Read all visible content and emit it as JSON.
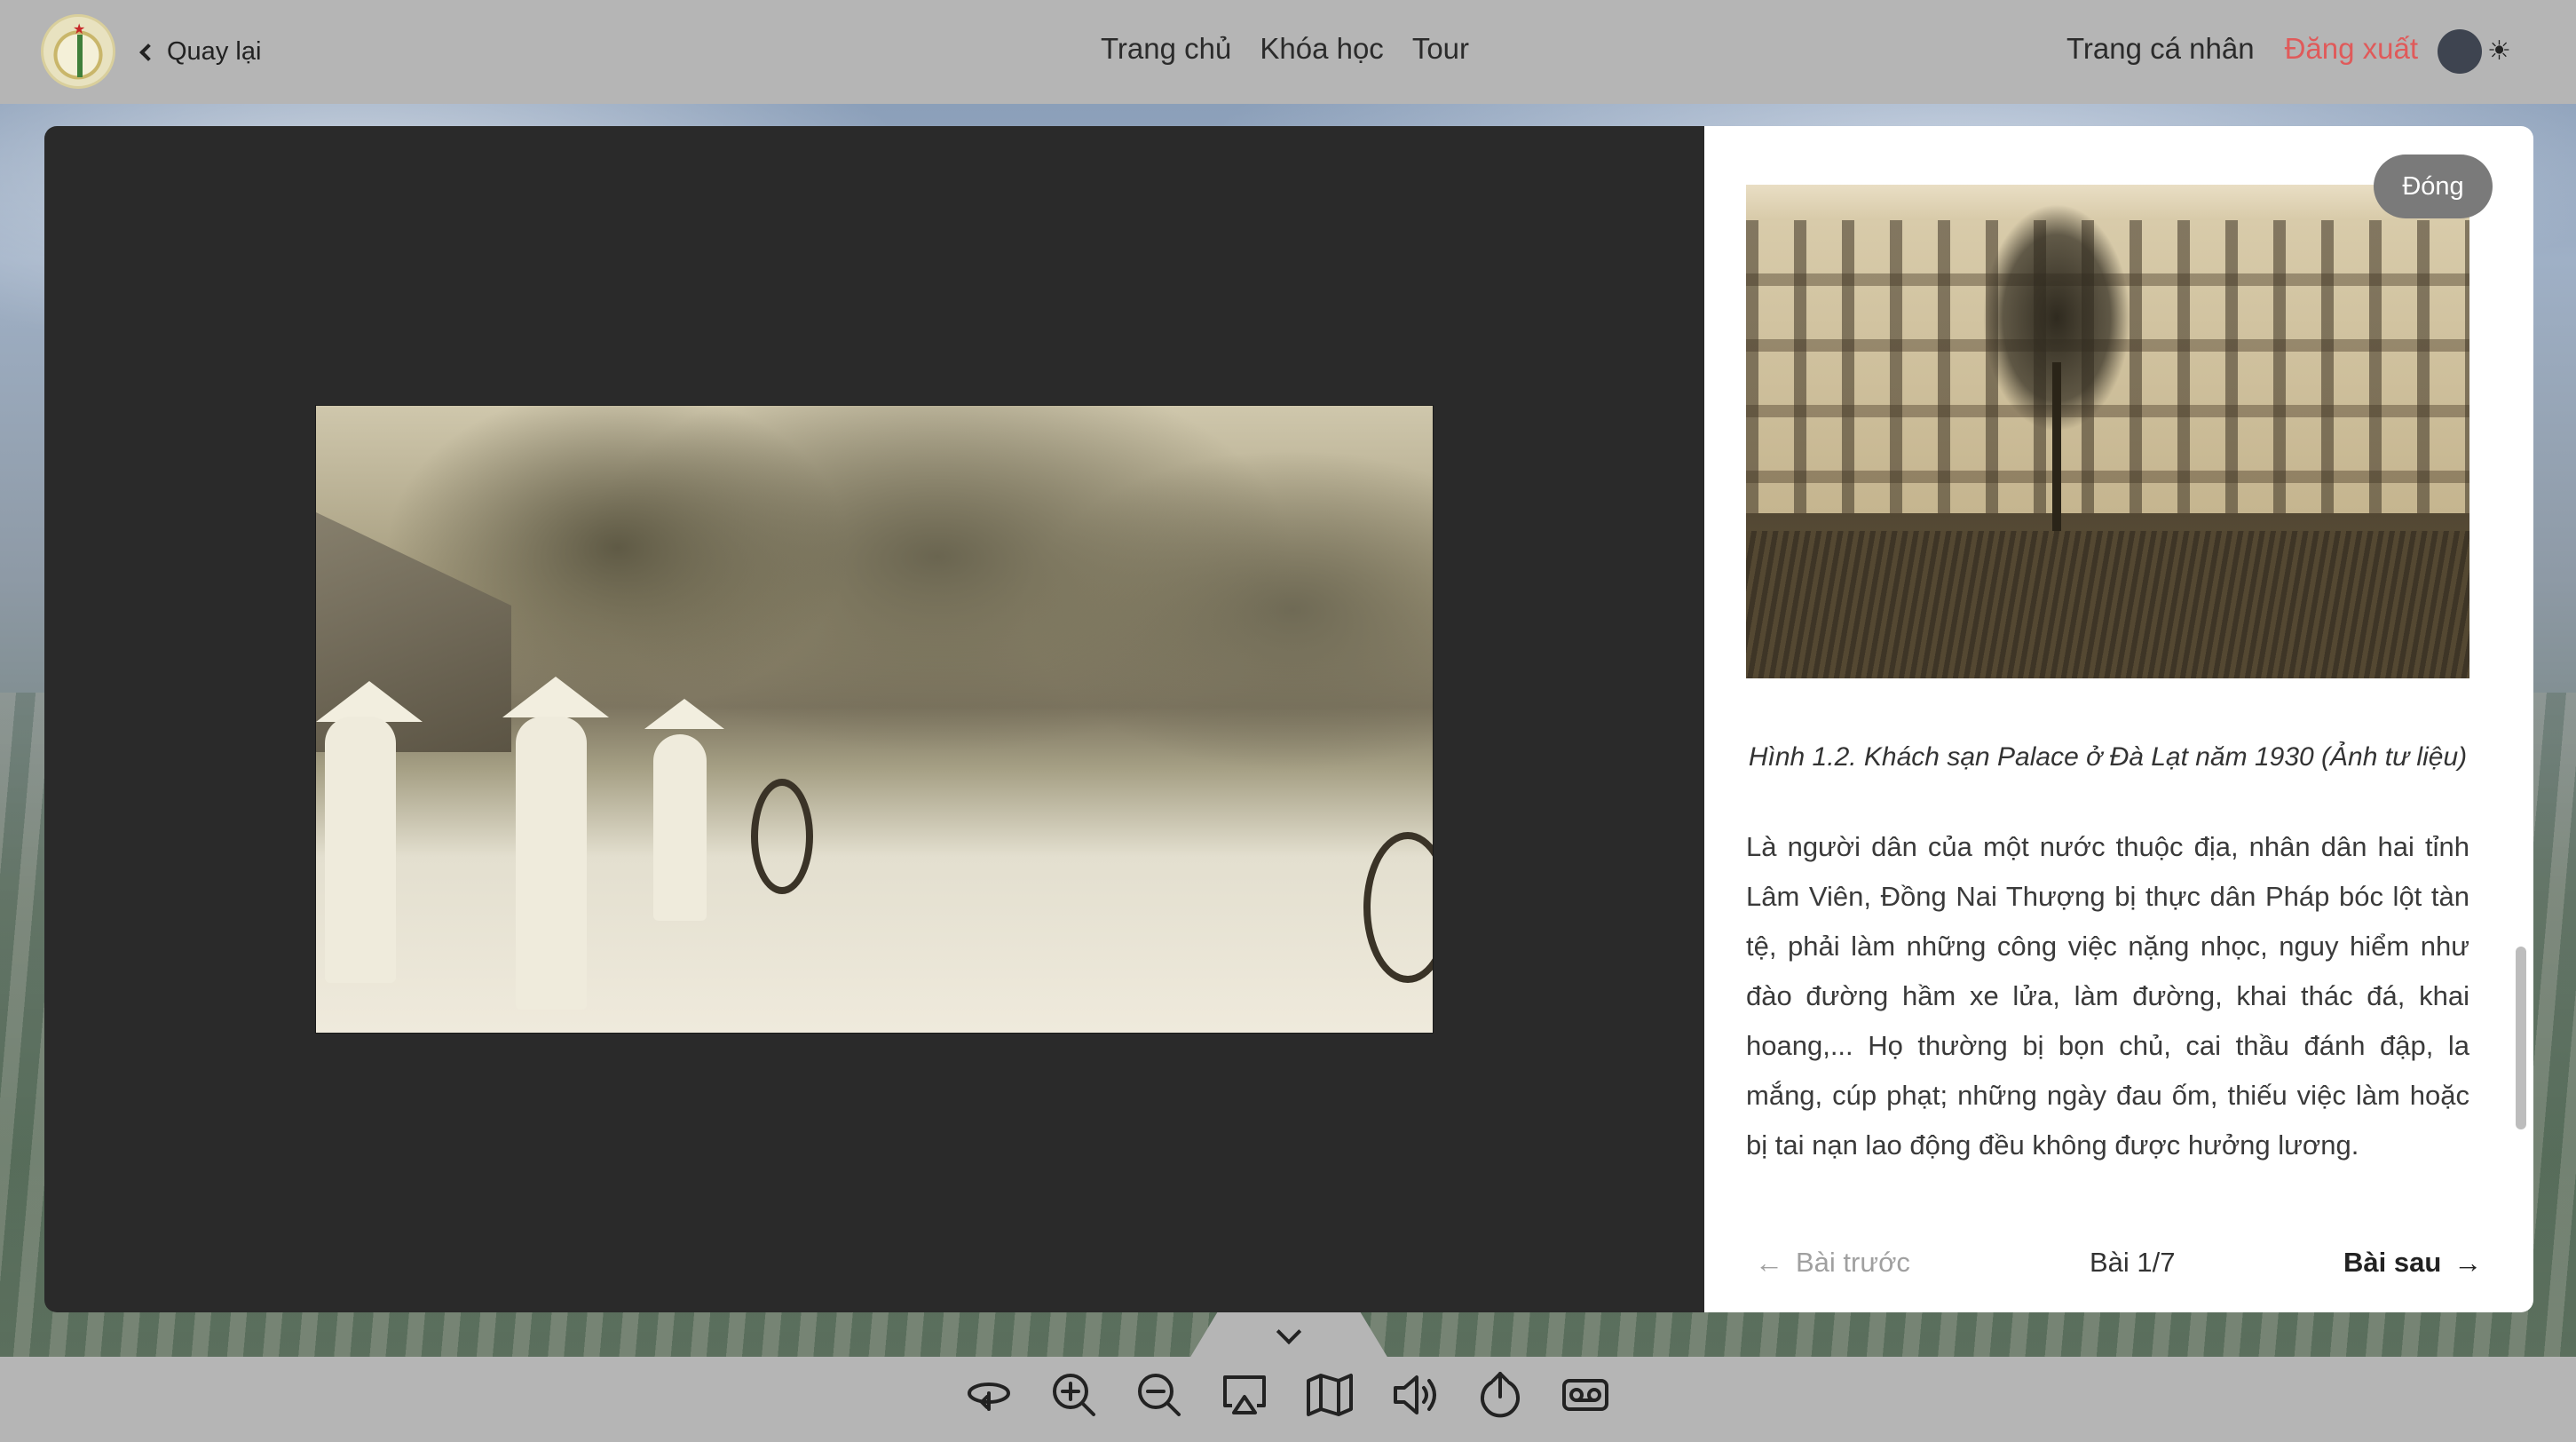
{
  "header": {
    "back_label": "Quay lại",
    "nav": [
      "Trang chủ",
      "Khóa học",
      "Tour"
    ],
    "profile_label": "Trang cá nhân",
    "logout_label": "Đăng xuất",
    "logout_color": "#e05a5a"
  },
  "panel": {
    "close_label": "Đóng",
    "caption": "Hình 1.2. Khách sạn Palace ở Đà Lạt năm 1930 (Ảnh tư liệu)",
    "body": "Là người dân của một nước thuộc địa, nhân dân hai tỉnh Lâm Viên, Đồng Nai Thượng bị thực dân Pháp bóc lột tàn tệ, phải làm những công việc nặng nhọc, nguy hiểm như đào đường hầm xe lửa, làm đường, khai thác đá, khai hoang,... Họ thường bị bọn chủ, cai thầu đánh đập, la mắng, cúp phạt; những ngày đau ốm, thiếu việc làm hoặc bị tai nạn lao động đều không được hưởng lương.",
    "pager": {
      "prev_label": "Bài trước",
      "count": "Bài 1/7",
      "next_label": "Bài sau"
    }
  },
  "toolbar": {
    "icons": [
      "rotate-icon",
      "zoom-in-icon",
      "zoom-out-icon",
      "cast-icon",
      "map-icon",
      "volume-icon",
      "share-icon",
      "voicemail-icon"
    ]
  }
}
